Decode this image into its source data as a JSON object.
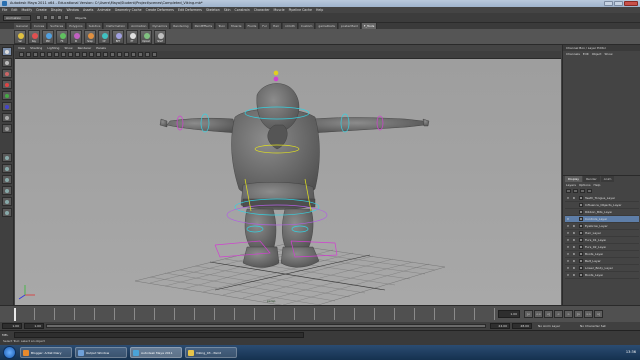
{
  "window": {
    "title": "Autodesk Maya 2011 x64 - Educational Version: C:\\Users\\Maya\\Student\\Project\\scenes\\Completed_Viking.mb*",
    "controls": [
      "minimize",
      "maximize",
      "close"
    ]
  },
  "menubar": [
    "File",
    "Edit",
    "Modify",
    "Create",
    "Display",
    "Window",
    "Assets",
    "Animate",
    "Geometry Cache",
    "Create Deformers",
    "Edit Deformers",
    "Skeleton",
    "Skin",
    "Constrain",
    "Character",
    "Muscle",
    "Pipeline Cache",
    "Help"
  ],
  "statusline": {
    "mode": "Animation",
    "objects_label": "Objects"
  },
  "shelf": {
    "tabs": [
      "General",
      "Curves",
      "Surfaces",
      "Polygons",
      "Subdivs",
      "Deformation",
      "Animation",
      "Dynamics",
      "Rendering",
      "PaintEffects",
      "Toon",
      "Muscle",
      "Fluids",
      "Fur",
      "Hair",
      "nCloth",
      "Custom",
      "gameRoids",
      "posterMaid",
      "F_Tools"
    ],
    "active_tab": "F_Tools",
    "buttons": [
      "Sel",
      "Key",
      "Mirr",
      "FK",
      "IK",
      "Snap",
      "CP",
      "BPT",
      "PT",
      "Upload",
      "Shelf"
    ]
  },
  "panel": {
    "menu": [
      "View",
      "Shading",
      "Lighting",
      "Show",
      "Renderer",
      "Panels"
    ],
    "camera_label": "persp"
  },
  "channel_box": {
    "title": "Channel Box / Layer Editor",
    "menu": [
      "Channels",
      "Edit",
      "Object",
      "Show"
    ]
  },
  "layer_editor": {
    "tabs": [
      "Display",
      "Render",
      "Anim"
    ],
    "active_tab": "Display",
    "menu": [
      "Layers",
      "Options",
      "Help"
    ],
    "layers": [
      {
        "v": "V",
        "r": "R",
        "name": "Teeth_Tongue_Layer",
        "selected": false
      },
      {
        "v": "",
        "r": "",
        "name": "Influence_Objects_Layer",
        "selected": false
      },
      {
        "v": "",
        "r": "",
        "name": "Ribbon_Bits_Layer",
        "selected": false
      },
      {
        "v": "V",
        "r": "",
        "name": "Controls_Layer",
        "selected": true
      },
      {
        "v": "V",
        "r": "R",
        "name": "Eyebrow_Layer",
        "selected": false
      },
      {
        "v": "V",
        "r": "R",
        "name": "Hair_Layer",
        "selected": false
      },
      {
        "v": "V",
        "r": "R",
        "name": "Furs_01_Layer",
        "selected": false
      },
      {
        "v": "V",
        "r": "R",
        "name": "Furs_02_Layer",
        "selected": false
      },
      {
        "v": "V",
        "r": "R",
        "name": "Boots_Layer",
        "selected": false
      },
      {
        "v": "V",
        "r": "R",
        "name": "Belt_Layer",
        "selected": false
      },
      {
        "v": "V",
        "r": "R",
        "name": "Lower_Body_Layer",
        "selected": false
      },
      {
        "v": "V",
        "r": "R",
        "name": "Boots_Layer",
        "selected": false
      }
    ]
  },
  "time_slider": {
    "current_frame": "1.00",
    "ticks": [
      "1",
      "5",
      "10",
      "15",
      "20",
      "25",
      "30",
      "35",
      "40",
      "45",
      "50",
      "55",
      "60",
      "65",
      "70",
      "75",
      "80",
      "85",
      "90",
      "95",
      "100",
      "105",
      "110",
      "115",
      "120"
    ],
    "play_buttons": [
      "|<",
      "<<",
      "<|",
      "<",
      ">",
      "|>",
      ">>",
      ">|"
    ]
  },
  "range_slider": {
    "start": "1.00",
    "inner_start": "1.00",
    "inner_end": "24.00",
    "end": "48.00",
    "anim_layer": "No Anim Layer",
    "char_set": "No Character Set"
  },
  "command_line": {
    "label": "MEL"
  },
  "help_line": {
    "text": "Select Tool: select an object"
  },
  "taskbar": {
    "tasks": [
      {
        "label": "Blogger: Artist Diary",
        "color": "#e88a2c"
      },
      {
        "label": "Output Window",
        "color": "#6fa0d8"
      },
      {
        "label": "Autodesk Maya 2011",
        "color": "#4aa3d8"
      },
      {
        "label": "Viking_03 - Paint",
        "color": "#e6c44a"
      }
    ],
    "clock": "13:36"
  }
}
